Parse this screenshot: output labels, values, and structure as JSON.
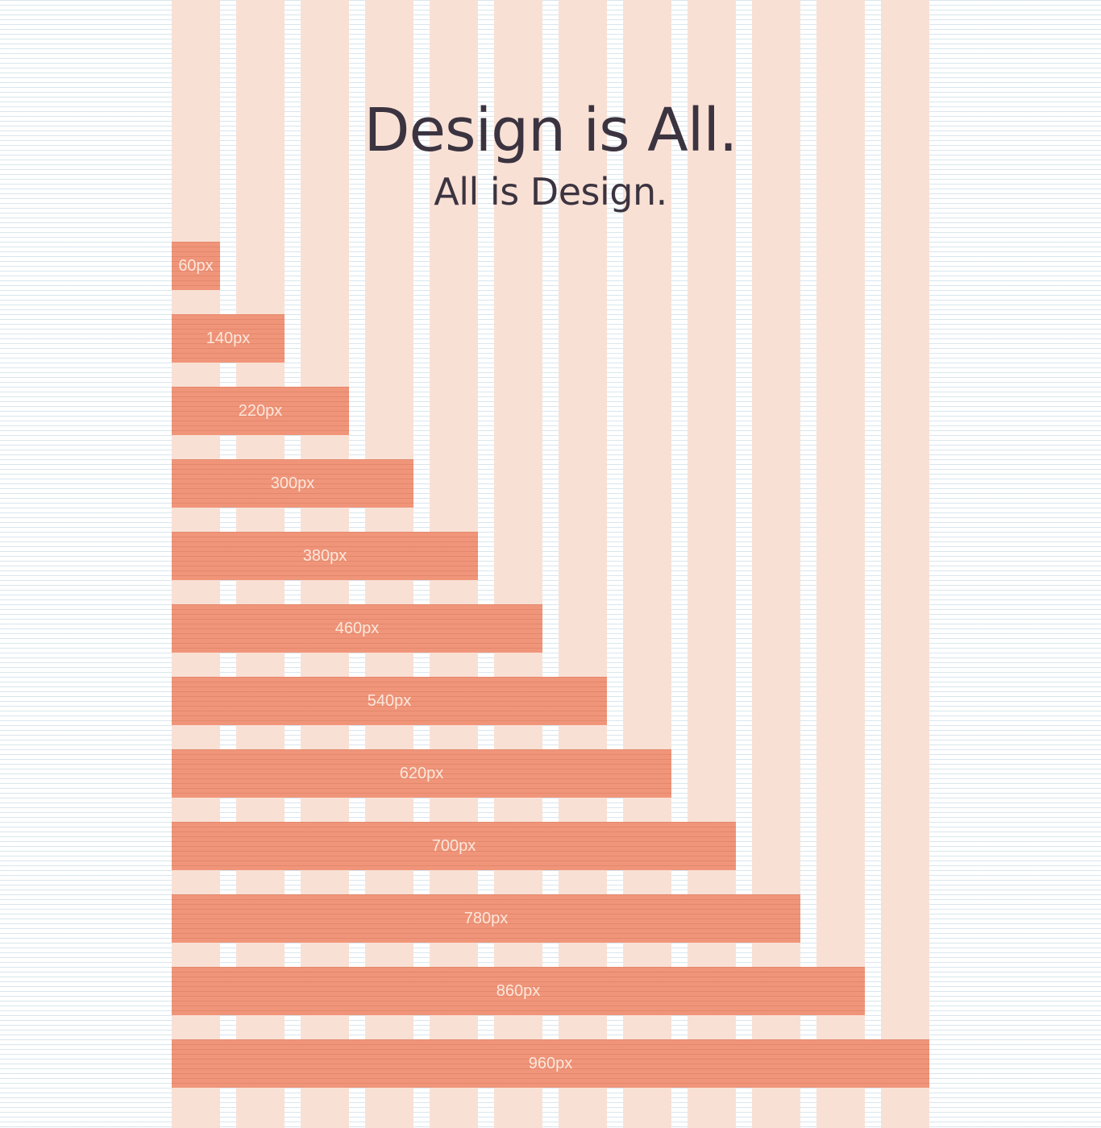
{
  "headline": {
    "title": "Design is All.",
    "subtitle": "All is Design."
  },
  "colors": {
    "column": "#f9e0d5",
    "bar": "#f0957a",
    "title_text": "#3b3440",
    "bar_text": "#fbe7dc"
  },
  "grid": {
    "columns": 12
  },
  "widths": [
    {
      "label": "60px",
      "columns": 1
    },
    {
      "label": "140px",
      "columns": 2
    },
    {
      "label": "220px",
      "columns": 3
    },
    {
      "label": "300px",
      "columns": 4
    },
    {
      "label": "380px",
      "columns": 5
    },
    {
      "label": "460px",
      "columns": 6
    },
    {
      "label": "540px",
      "columns": 7
    },
    {
      "label": "620px",
      "columns": 8
    },
    {
      "label": "700px",
      "columns": 9
    },
    {
      "label": "780px",
      "columns": 10
    },
    {
      "label": "860px",
      "columns": 11
    },
    {
      "label": "960px",
      "columns": 12
    }
  ]
}
